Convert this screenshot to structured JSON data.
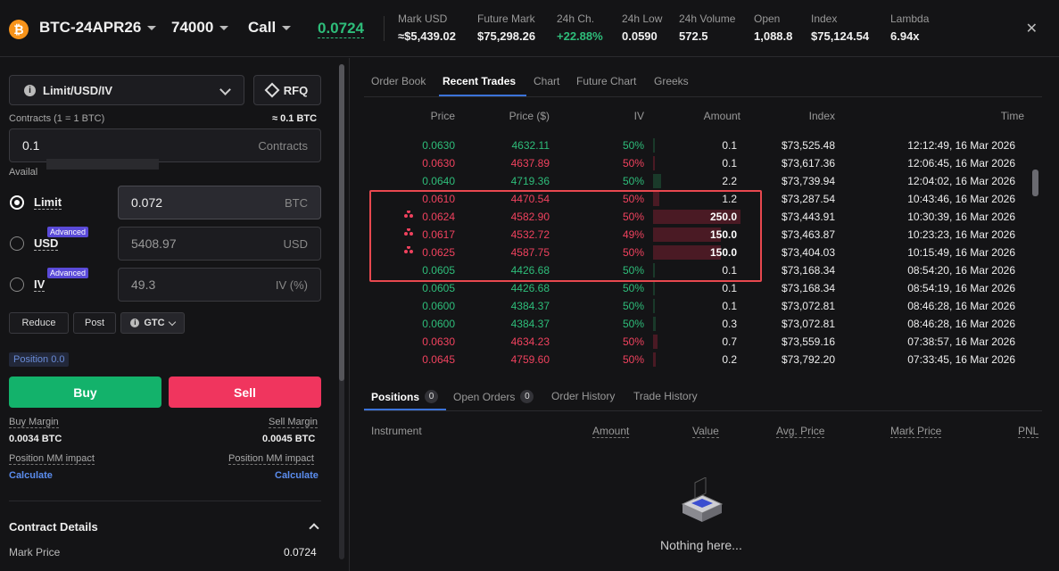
{
  "header": {
    "btc_glyph": "₿",
    "instrument": "BTC-24APR26",
    "strike": "74000",
    "side": "Call",
    "last_price": "0.0724",
    "close_glyph": "✕",
    "stats": [
      {
        "label": "Mark USD",
        "value": "≈$5,439.02",
        "green": false
      },
      {
        "label": "Future Mark",
        "value": "$75,298.26",
        "green": false
      },
      {
        "label": "24h Ch.",
        "value": "+22.88%",
        "green": true
      },
      {
        "label": "24h Low",
        "value": "0.0590",
        "green": false
      },
      {
        "label": "24h Volume",
        "value": "572.5",
        "green": false
      },
      {
        "label": "Open",
        "value": "1,088.8",
        "green": false
      },
      {
        "label": "Index",
        "value": "$75,124.54",
        "green": false
      },
      {
        "label": "Lambda",
        "value": "6.94x",
        "green": false
      }
    ]
  },
  "order_form": {
    "type_select": "Limit/USD/IV",
    "info_glyph": "i",
    "rfq_label": "RFQ",
    "contracts_label": "Contracts (1 = 1 BTC)",
    "contracts_approx": "≈ 0.1 BTC",
    "contracts_value": "0.1",
    "contracts_unit": "Contracts",
    "available_label": "Availal",
    "limit_label": "Limit",
    "limit_value": "0.072",
    "limit_unit": "BTC",
    "usd_label": "USD",
    "usd_value": "5408.97",
    "usd_unit": "USD",
    "iv_label": "IV",
    "iv_value": "49.3",
    "iv_unit": "IV (%)",
    "advanced_label": "Advanced",
    "reduce_label": "Reduce",
    "post_label": "Post",
    "gtc_label": "GTC",
    "position_label": "Position 0.0",
    "buy_label": "Buy",
    "sell_label": "Sell",
    "buy_margin_label": "Buy Margin",
    "buy_margin_value": "0.0034 BTC",
    "sell_margin_label": "Sell Margin",
    "sell_margin_value": "0.0045 BTC",
    "mm_impact_label": "Position MM impact",
    "calculate_label": "Calculate",
    "contract_details_label": "Contract Details",
    "mark_price_label": "Mark Price",
    "mark_price_value": "0.0724"
  },
  "trades_panel": {
    "tabs": [
      "Order Book",
      "Recent Trades",
      "Chart",
      "Future Chart",
      "Greeks"
    ],
    "active_tab": 1,
    "headers": [
      "Price",
      "Price ($)",
      "IV",
      "Amount",
      "Index",
      "Time"
    ],
    "max_amount": 250,
    "rows": [
      {
        "price": "0.0630",
        "price_usd": "4632.11",
        "iv": "50%",
        "amount": "0.1",
        "amount_num": 0.1,
        "index": "$73,525.48",
        "time": "12:12:49, 16 Mar 2026",
        "color": "grn",
        "block": false
      },
      {
        "price": "0.0630",
        "price_usd": "4637.89",
        "iv": "50%",
        "amount": "0.1",
        "amount_num": 0.1,
        "index": "$73,617.36",
        "time": "12:06:45, 16 Mar 2026",
        "color": "red",
        "block": false
      },
      {
        "price": "0.0640",
        "price_usd": "4719.36",
        "iv": "50%",
        "amount": "2.2",
        "amount_num": 2.2,
        "index": "$73,739.94",
        "time": "12:04:02, 16 Mar 2026",
        "color": "grn",
        "block": false
      },
      {
        "price": "0.0610",
        "price_usd": "4470.54",
        "iv": "50%",
        "amount": "1.2",
        "amount_num": 1.2,
        "index": "$73,287.54",
        "time": "10:43:46, 16 Mar 2026",
        "color": "red",
        "block": false
      },
      {
        "price": "0.0624",
        "price_usd": "4582.90",
        "iv": "50%",
        "amount": "250.0",
        "amount_num": 250,
        "index": "$73,443.91",
        "time": "10:30:39, 16 Mar 2026",
        "color": "red",
        "block": true
      },
      {
        "price": "0.0617",
        "price_usd": "4532.72",
        "iv": "49%",
        "amount": "150.0",
        "amount_num": 150,
        "index": "$73,463.87",
        "time": "10:23:23, 16 Mar 2026",
        "color": "red",
        "block": true
      },
      {
        "price": "0.0625",
        "price_usd": "4587.75",
        "iv": "50%",
        "amount": "150.0",
        "amount_num": 150,
        "index": "$73,404.03",
        "time": "10:15:49, 16 Mar 2026",
        "color": "red",
        "block": true
      },
      {
        "price": "0.0605",
        "price_usd": "4426.68",
        "iv": "50%",
        "amount": "0.1",
        "amount_num": 0.1,
        "index": "$73,168.34",
        "time": "08:54:20, 16 Mar 2026",
        "color": "grn",
        "block": false
      },
      {
        "price": "0.0605",
        "price_usd": "4426.68",
        "iv": "50%",
        "amount": "0.1",
        "amount_num": 0.1,
        "index": "$73,168.34",
        "time": "08:54:19, 16 Mar 2026",
        "color": "grn",
        "block": false
      },
      {
        "price": "0.0600",
        "price_usd": "4384.37",
        "iv": "50%",
        "amount": "0.1",
        "amount_num": 0.1,
        "index": "$73,072.81",
        "time": "08:46:28, 16 Mar 2026",
        "color": "grn",
        "block": false
      },
      {
        "price": "0.0600",
        "price_usd": "4384.37",
        "iv": "50%",
        "amount": "0.3",
        "amount_num": 0.3,
        "index": "$73,072.81",
        "time": "08:46:28, 16 Mar 2026",
        "color": "grn",
        "block": false
      },
      {
        "price": "0.0630",
        "price_usd": "4634.23",
        "iv": "50%",
        "amount": "0.7",
        "amount_num": 0.7,
        "index": "$73,559.16",
        "time": "07:38:57, 16 Mar 2026",
        "color": "red",
        "block": false
      },
      {
        "price": "0.0645",
        "price_usd": "4759.60",
        "iv": "50%",
        "amount": "0.2",
        "amount_num": 0.2,
        "index": "$73,792.20",
        "time": "07:33:45, 16 Mar 2026",
        "color": "red",
        "block": false
      }
    ]
  },
  "bottom_panel": {
    "tabs": [
      {
        "label": "Positions",
        "count": "0"
      },
      {
        "label": "Open Orders",
        "count": "0"
      },
      {
        "label": "Order History",
        "count": ""
      },
      {
        "label": "Trade History",
        "count": ""
      }
    ],
    "headers": [
      "Instrument",
      "Amount",
      "Value",
      "Avg. Price",
      "Mark Price",
      "PNL"
    ],
    "empty_text": "Nothing here..."
  },
  "colors": {
    "green": "#2ebd7a",
    "red": "#f0425e",
    "accent": "#3b73d9",
    "buy": "#13b26b",
    "sell": "#f0355e"
  }
}
